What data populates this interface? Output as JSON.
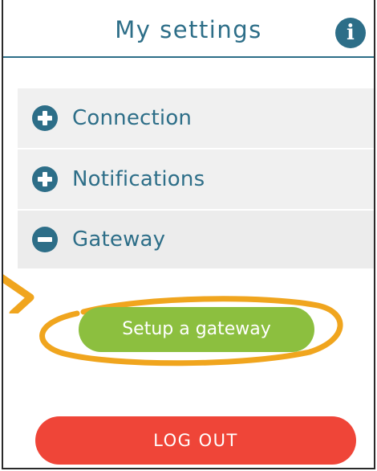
{
  "header": {
    "title": "My settings",
    "info_icon": "info-icon"
  },
  "menu": {
    "items": [
      {
        "label": "Connection",
        "icon": "plus-circle-icon",
        "expanded": false
      },
      {
        "label": "Notifications",
        "icon": "plus-circle-icon",
        "expanded": false
      },
      {
        "label": "Gateway",
        "icon": "minus-circle-icon",
        "expanded": true
      }
    ]
  },
  "gateway": {
    "setup_label": "Setup a gateway"
  },
  "logout": {
    "label": "LOG OUT"
  },
  "colors": {
    "primary": "#2d6e88",
    "setup_button": "#8cbf3f",
    "logout_button": "#ef4538",
    "highlight": "#f0a51e",
    "row_background": "#f0f0f0"
  }
}
